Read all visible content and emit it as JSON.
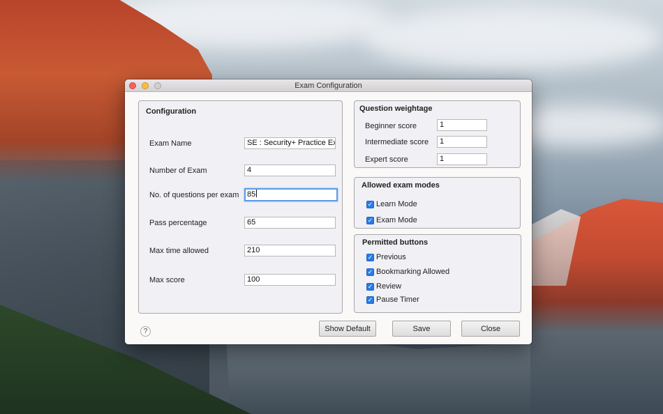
{
  "window": {
    "title": "Exam Configuration"
  },
  "configuration": {
    "title": "Configuration",
    "fields": [
      {
        "label": "Exam Name",
        "value": "SE : Security+ Practice Exa"
      },
      {
        "label": "Number of Exam",
        "value": "4"
      },
      {
        "label": "No. of questions per exam",
        "value": "85"
      },
      {
        "label": "Pass percentage",
        "value": "65"
      },
      {
        "label": "Max time allowed",
        "value": "210"
      },
      {
        "label": "Max score",
        "value": "100"
      }
    ]
  },
  "weightage": {
    "title": "Question weightage",
    "fields": [
      {
        "label": "Beginner score",
        "value": "1"
      },
      {
        "label": "Intermediate score",
        "value": "1"
      },
      {
        "label": "Expert score",
        "value": "1"
      }
    ]
  },
  "modes": {
    "title": "Allowed exam modes",
    "items": [
      {
        "label": "Learn Mode",
        "checked": true
      },
      {
        "label": "Exam Mode",
        "checked": true
      }
    ]
  },
  "permitted": {
    "title": "Permitted buttons",
    "items": [
      {
        "label": "Previous",
        "checked": true
      },
      {
        "label": "Bookmarking Allowed",
        "checked": true
      },
      {
        "label": "Review",
        "checked": true
      },
      {
        "label": "Pause Timer",
        "checked": true
      }
    ]
  },
  "buttons": {
    "help": "?",
    "show_default": "Show Default",
    "save": "Save",
    "close": "Close"
  },
  "icons": {
    "check": "check-icon",
    "help": "question-mark-icon"
  },
  "colors": {
    "checkbox": "#2a7be4",
    "focus_ring": "#5b9be6",
    "close_light": "#fc605c",
    "minimize_light": "#fdbc40"
  }
}
